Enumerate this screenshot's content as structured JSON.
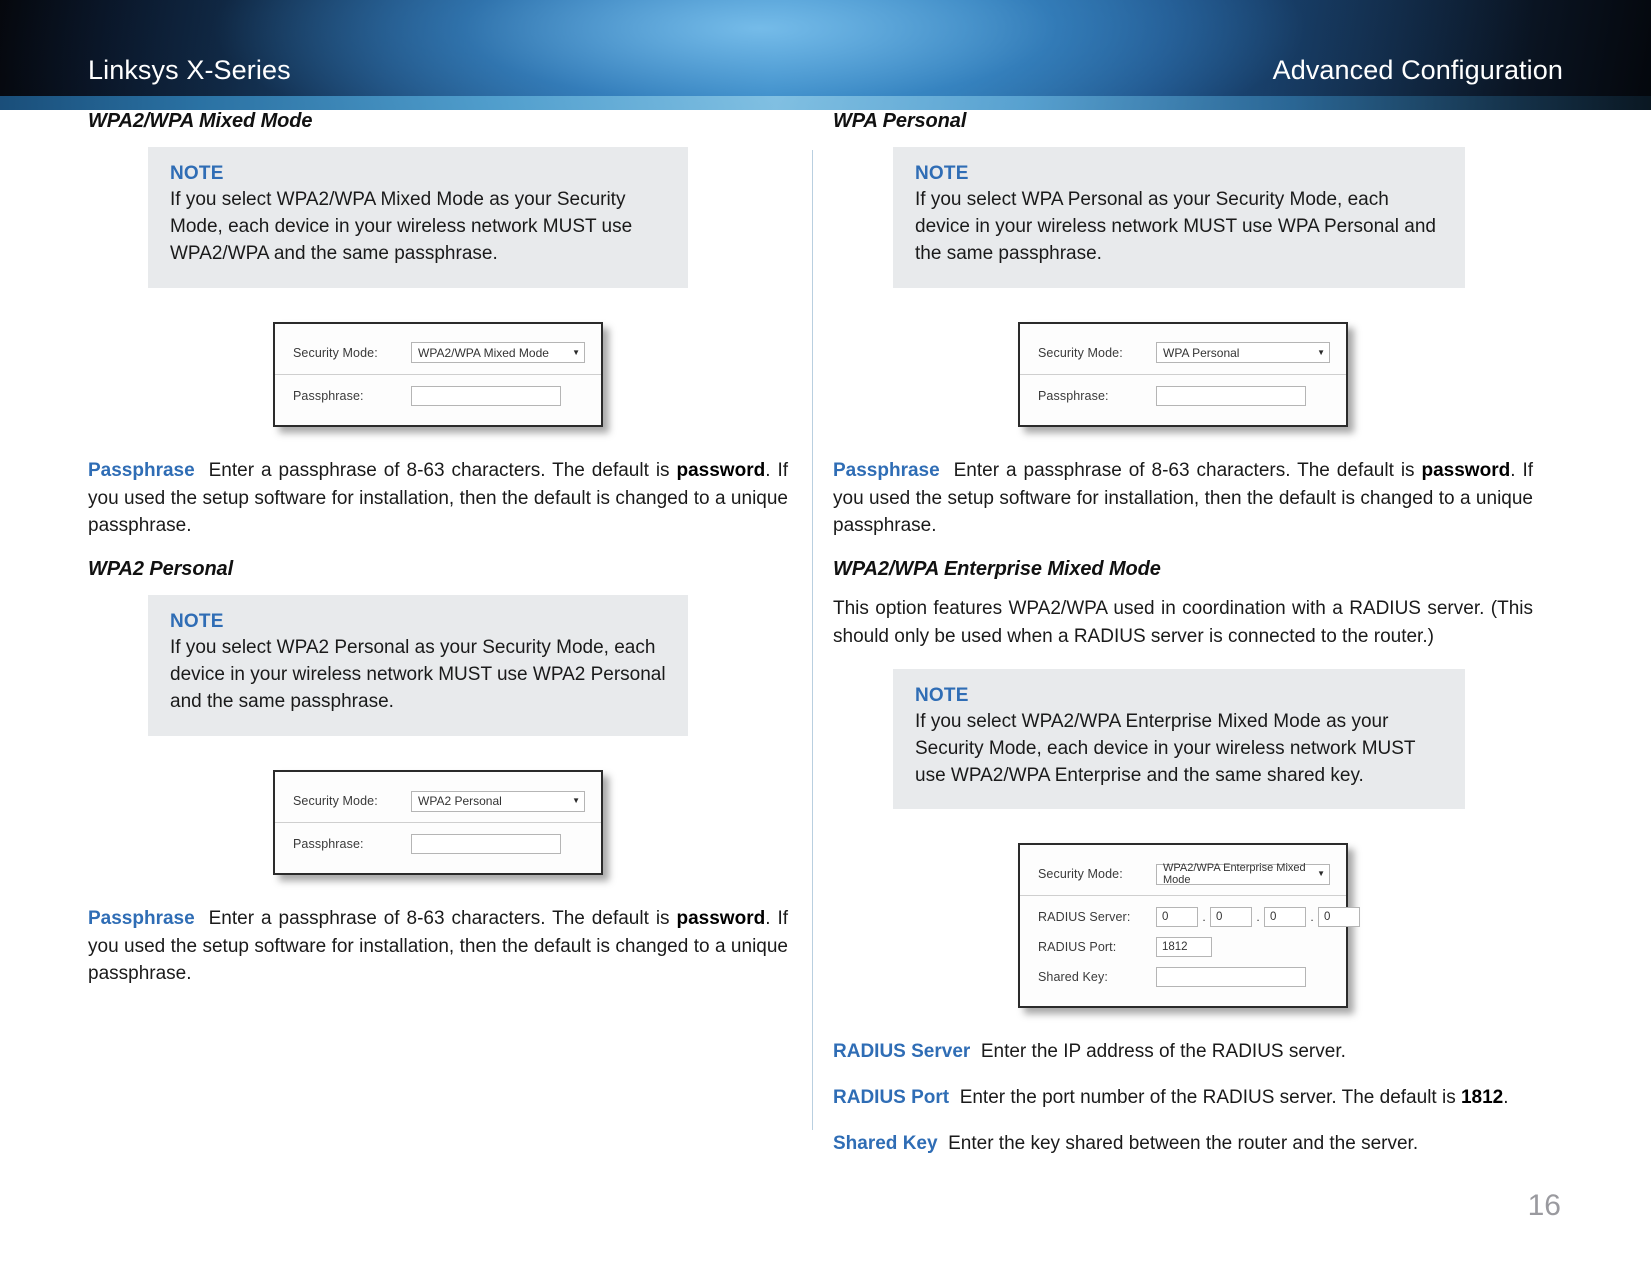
{
  "header": {
    "left_title": "Linksys X-Series",
    "right_title": "Advanced Configuration"
  },
  "footer": {
    "page_number": "16"
  },
  "colors": {
    "accent_blue": "#2f6db5",
    "note_background": "#e8eaec",
    "header_gradient_light": "#3d8ec4",
    "page_number_gray": "#9a9a9f"
  },
  "left_column": {
    "section1": {
      "heading": "WPA2/WPA Mixed Mode",
      "note": {
        "title": "NOTE",
        "text": "If you select WPA2/WPA Mixed Mode as your Security Mode, each device in your wireless network MUST use WPA2/WPA and the same passphrase."
      },
      "screenshot": {
        "security_mode_label": "Security Mode:",
        "security_mode_value": "WPA2/WPA Mixed Mode",
        "passphrase_label": "Passphrase:",
        "passphrase_value": ""
      },
      "passphrase_para": {
        "term": "Passphrase",
        "text_before": "Enter a passphrase of 8-63 characters. The default is ",
        "bold_word": "password",
        "text_after": ". If you used the setup software for installation, then the default is changed to a unique passphrase."
      }
    },
    "section2": {
      "heading": "WPA2 Personal",
      "note": {
        "title": "NOTE",
        "text": "If you select WPA2 Personal as your Security Mode, each device in your wireless network MUST use WPA2 Personal and the same passphrase."
      },
      "screenshot": {
        "security_mode_label": "Security Mode:",
        "security_mode_value": "WPA2 Personal",
        "passphrase_label": "Passphrase:",
        "passphrase_value": ""
      },
      "passphrase_para": {
        "term": "Passphrase",
        "text_before": "Enter a passphrase of 8-63 characters. The default is ",
        "bold_word": "password",
        "text_after": ". If you used the setup software for installation, then the default is changed to a unique passphrase."
      }
    }
  },
  "right_column": {
    "section1": {
      "heading": "WPA Personal",
      "note": {
        "title": "NOTE",
        "text": "If you select WPA Personal as your Security Mode, each device in your wireless network MUST use WPA Personal and the same passphrase."
      },
      "screenshot": {
        "security_mode_label": "Security Mode:",
        "security_mode_value": "WPA Personal",
        "passphrase_label": "Passphrase:",
        "passphrase_value": ""
      },
      "passphrase_para": {
        "term": "Passphrase",
        "text_before": "Enter a passphrase of 8-63 characters. The default is ",
        "bold_word": "password",
        "text_after": ". If you used the setup software for installation, then the default is changed to a unique passphrase."
      }
    },
    "section2": {
      "heading": "WPA2/WPA Enterprise Mixed Mode",
      "intro": "This option features WPA2/WPA used in coordination with a RADIUS server. (This should only be used when a RADIUS server is connected to the router.)",
      "note": {
        "title": "NOTE",
        "text": "If you select WPA2/WPA Enterprise Mixed Mode as your Security Mode, each device in your wireless network MUST use WPA2/WPA Enterprise and the same shared key."
      },
      "screenshot": {
        "security_mode_label": "Security Mode:",
        "security_mode_value": "WPA2/WPA Enterprise Mixed Mode",
        "radius_server_label": "RADIUS Server:",
        "radius_server_octets": [
          "0",
          "0",
          "0",
          "0"
        ],
        "radius_port_label": "RADIUS Port:",
        "radius_port_value": "1812",
        "shared_key_label": "Shared Key:",
        "shared_key_value": ""
      },
      "definitions": [
        {
          "term": "RADIUS Server",
          "text_before": "Enter the IP address of the RADIUS server.",
          "bold_word": "",
          "text_after": ""
        },
        {
          "term": "RADIUS Port",
          "text_before": "Enter the port number of the RADIUS server. The default is ",
          "bold_word": "1812",
          "text_after": "."
        },
        {
          "term": "Shared Key",
          "text_before": "Enter the key shared between the router and the server.",
          "bold_word": "",
          "text_after": ""
        }
      ]
    }
  }
}
